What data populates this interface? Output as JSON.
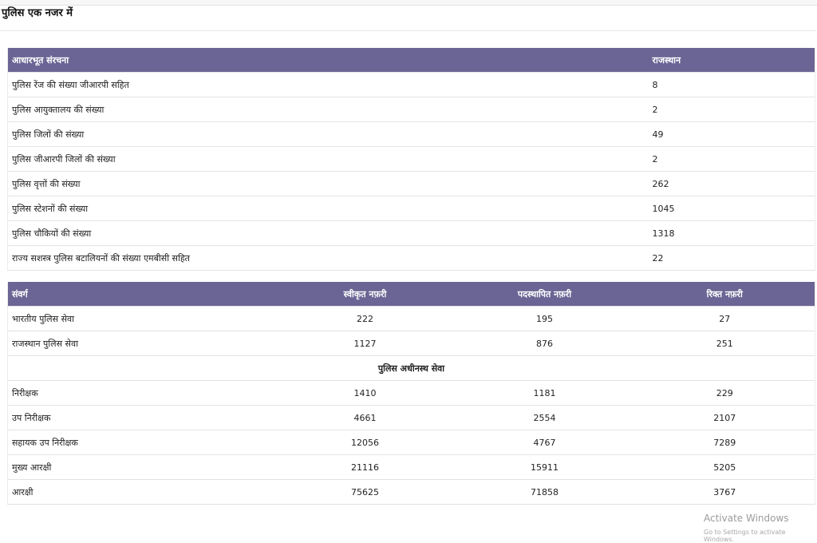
{
  "page": {
    "title": "पुलिस एक नजर में"
  },
  "infrastructure": {
    "headers": [
      "आधारभूत संरचना",
      "राजस्थान"
    ],
    "rows": [
      {
        "label": "पुलिस रेंज की संख्या जीआरपी सहित",
        "value": "8"
      },
      {
        "label": "पुलिस आयुक्तालय की संख्या",
        "value": "2"
      },
      {
        "label": "पुलिस जिलों की संख्या",
        "value": "49"
      },
      {
        "label": "पुलिस जीआरपी जिलों की संख्या",
        "value": "2"
      },
      {
        "label": "पुलिस वृत्तों की संख्या",
        "value": "262"
      },
      {
        "label": "पुलिस स्टेशनों की संख्या",
        "value": "1045"
      },
      {
        "label": "पुलिस चौकियों की संख्या",
        "value": "1318"
      },
      {
        "label": "राज्य सशस्त्र पुलिस बटालियनों की संख्या एमबीसी सहित",
        "value": "22"
      }
    ]
  },
  "cadre": {
    "headers": [
      "संवर्ग",
      "स्वीकृत नफ़री",
      "पदस्थापित नफ़री",
      "रिक्त नफ़री"
    ],
    "rows_top": [
      {
        "cadre": "भारतीय पुलिस सेवा",
        "sanctioned": "222",
        "posted": "195",
        "vacant": "27"
      },
      {
        "cadre": "राजस्थान पुलिस सेवा",
        "sanctioned": "1127",
        "posted": "876",
        "vacant": "251"
      }
    ],
    "section_label": "पुलिस अधीनस्थ सेवा",
    "rows_sub": [
      {
        "cadre": "निरीक्षक",
        "sanctioned": "1410",
        "posted": "1181",
        "vacant": "229"
      },
      {
        "cadre": "उप निरीक्षक",
        "sanctioned": "4661",
        "posted": "2554",
        "vacant": "2107"
      },
      {
        "cadre": "सहायक उप निरीक्षक",
        "sanctioned": "12056",
        "posted": "4767",
        "vacant": "7289"
      },
      {
        "cadre": "मुख्य आरक्षी",
        "sanctioned": "21116",
        "posted": "15911",
        "vacant": "5205"
      },
      {
        "cadre": "आरक्षी",
        "sanctioned": "75625",
        "posted": "71858",
        "vacant": "3767"
      }
    ]
  },
  "watermark": {
    "title": "Activate Windows",
    "subtitle": "Go to Settings to activate Windows."
  },
  "colors": {
    "header_bg": "#6b6595",
    "header_text": "#ffffff"
  }
}
